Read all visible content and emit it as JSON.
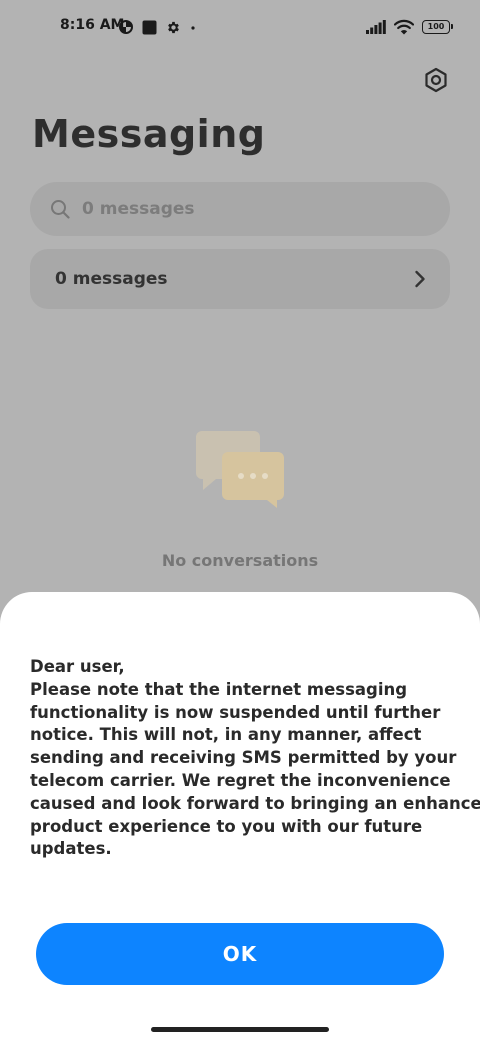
{
  "status_bar": {
    "time": "8:16 AM",
    "battery_level": "100",
    "left_icons": [
      "data-saver-icon",
      "square-notification-icon",
      "settings-gear-icon",
      "dot-icon"
    ],
    "right_icons": [
      "signal-icon",
      "wifi-icon",
      "battery-icon"
    ]
  },
  "header": {
    "title": "Messaging",
    "settings_icon": "settings-gear-icon"
  },
  "search": {
    "placeholder": "0 messages"
  },
  "messages_row": {
    "label": "0 messages"
  },
  "empty_state": {
    "icon": "chat-bubbles-icon",
    "label": "No conversations"
  },
  "dialog": {
    "lines": [
      "Dear user,",
      "Please note that the internet messaging",
      "functionality is now suspended until further",
      "notice. This will not, in any manner, affect",
      "sending and receiving SMS permitted by your",
      "telecom carrier. We regret the inconvenience",
      "caused and look forward to bringing an enhanced",
      "product experience to you with our future",
      "updates."
    ],
    "ok_label": "OK"
  },
  "colors": {
    "dim_background": "#b3b3b3",
    "accent": "#0d84ff",
    "empty_icon": "#d6c49e"
  }
}
